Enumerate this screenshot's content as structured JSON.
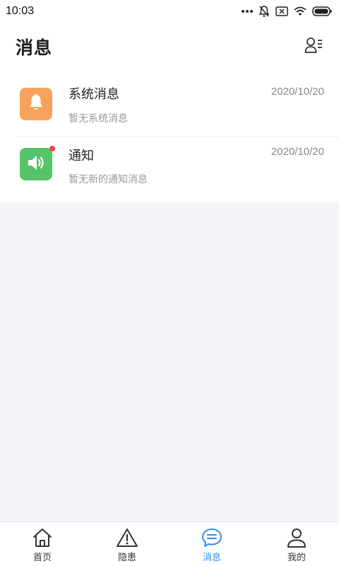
{
  "status_bar": {
    "time": "10:03"
  },
  "header": {
    "title": "消息"
  },
  "messages": [
    {
      "title": "系统消息",
      "description": "暂无系统消息",
      "date": "2020/10/20",
      "icon": "bell-icon",
      "icon_color": "#f7a25a"
    },
    {
      "title": "通知",
      "description": "暂无新的通知消息",
      "date": "2020/10/20",
      "icon": "speaker-icon",
      "icon_color": "#55c46b",
      "unread": true
    }
  ],
  "tabbar": {
    "tabs": [
      {
        "label": "首页",
        "icon": "home-icon",
        "active": false
      },
      {
        "label": "隐患",
        "icon": "warning-icon",
        "active": false
      },
      {
        "label": "消息",
        "icon": "message-icon",
        "active": true
      },
      {
        "label": "我的",
        "icon": "person-icon",
        "active": false
      }
    ],
    "active_color": "#2b8ff0"
  }
}
